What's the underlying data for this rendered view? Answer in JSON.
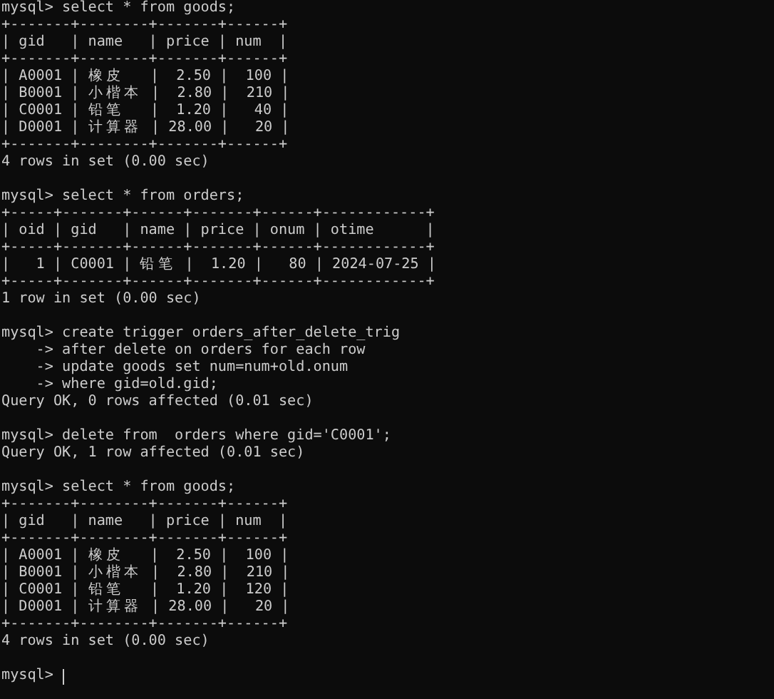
{
  "terminal": {
    "blocks": [
      [
        "mysql> select * from goods;",
        "+-------+--------+-------+------+",
        "| gid   | name   | price | num  |",
        "+-------+--------+-------+------+",
        "| A0001 | 橡皮   |  2.50 |  100 |",
        "| B0001 | 小楷本 |  2.80 |  210 |",
        "| C0001 | 铅笔   |  1.20 |   40 |",
        "| D0001 | 计算器 | 28.00 |   20 |",
        "+-------+--------+-------+------+",
        "4 rows in set (0.00 sec)"
      ],
      [
        "mysql> select * from orders;",
        "+-----+-------+------+-------+------+------------+",
        "| oid | gid   | name | price | onum | otime      |",
        "+-----+-------+------+-------+------+------------+",
        "|   1 | C0001 | 铅笔 |  1.20 |   80 | 2024-07-25 |",
        "+-----+-------+------+-------+------+------------+",
        "1 row in set (0.00 sec)"
      ],
      [
        "mysql> create trigger orders_after_delete_trig",
        "    -> after delete on orders for each row",
        "    -> update goods set num=num+old.onum",
        "    -> where gid=old.gid;",
        "Query OK, 0 rows affected (0.01 sec)"
      ],
      [
        "mysql> delete from  orders where gid='C0001';",
        "Query OK, 1 row affected (0.01 sec)"
      ],
      [
        "mysql> select * from goods;",
        "+-------+--------+-------+------+",
        "| gid   | name   | price | num  |",
        "+-------+--------+-------+------+",
        "| A0001 | 橡皮   |  2.50 |  100 |",
        "| B0001 | 小楷本 |  2.80 |  210 |",
        "| C0001 | 铅笔   |  1.20 |  120 |",
        "| D0001 | 计算器 | 28.00 |   20 |",
        "+-------+--------+-------+------+",
        "4 rows in set (0.00 sec)"
      ]
    ],
    "prompt": {
      "text": "mysql>",
      "cursor": true
    }
  }
}
